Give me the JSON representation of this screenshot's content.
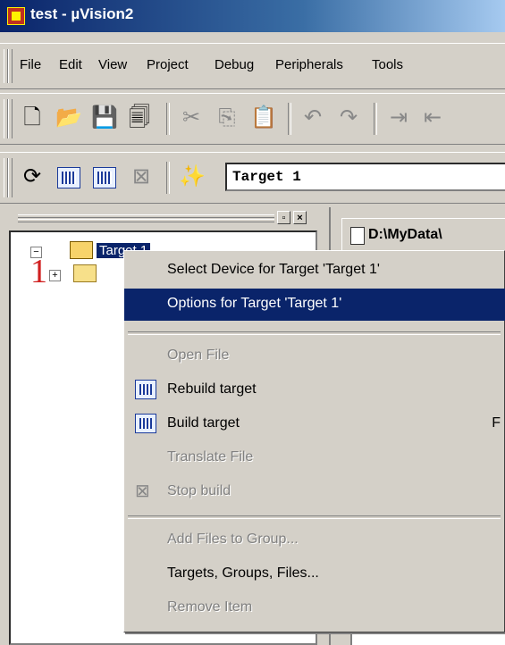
{
  "window": {
    "title": "test - µVision2"
  },
  "menubar": {
    "items": [
      "File",
      "Edit",
      "View",
      "Project",
      "Debug",
      "Peripherals",
      "Tools"
    ]
  },
  "toolbar": {
    "standard_icons": [
      "new-file-icon",
      "open-folder-icon",
      "save-icon",
      "save-all-icon",
      "cut-icon",
      "copy-icon",
      "paste-icon",
      "undo-icon",
      "redo-icon",
      "indent-icon",
      "outdent-icon"
    ],
    "build_icons": [
      "translate-icon",
      "build-icon",
      "rebuild-icon",
      "stop-build-icon",
      "options-wand-icon"
    ],
    "target_select": "Target 1"
  },
  "project_pane": {
    "tree": {
      "root_label": "Target 1",
      "child_label": ""
    },
    "annotation": "1"
  },
  "document": {
    "tab_label": "D:\\MyData\\"
  },
  "context_menu": {
    "items": [
      {
        "label": "Select Device for Target 'Target 1'",
        "disabled": false,
        "selected": false
      },
      {
        "label": "Options for Target 'Target 1'",
        "disabled": false,
        "selected": true
      },
      {
        "label": "Open File",
        "disabled": true,
        "selected": false
      },
      {
        "label": "Rebuild target",
        "disabled": false,
        "selected": false,
        "icon": "rebuild-icon"
      },
      {
        "label": "Build target",
        "disabled": false,
        "selected": false,
        "icon": "build-icon",
        "shortcut": "F"
      },
      {
        "label": "Translate File",
        "disabled": true,
        "selected": false
      },
      {
        "label": "Stop build",
        "disabled": true,
        "selected": false,
        "icon": "stop-build-icon"
      },
      {
        "label": "Add Files to Group...",
        "disabled": true,
        "selected": false
      },
      {
        "label": "Targets, Groups, Files...",
        "disabled": false,
        "selected": false
      },
      {
        "label": "Remove Item",
        "disabled": true,
        "selected": false
      }
    ]
  },
  "colors": {
    "titlebar": "#0a246a",
    "selection": "#0a246a",
    "face": "#d4d0c8",
    "annotation": "#d02020"
  }
}
